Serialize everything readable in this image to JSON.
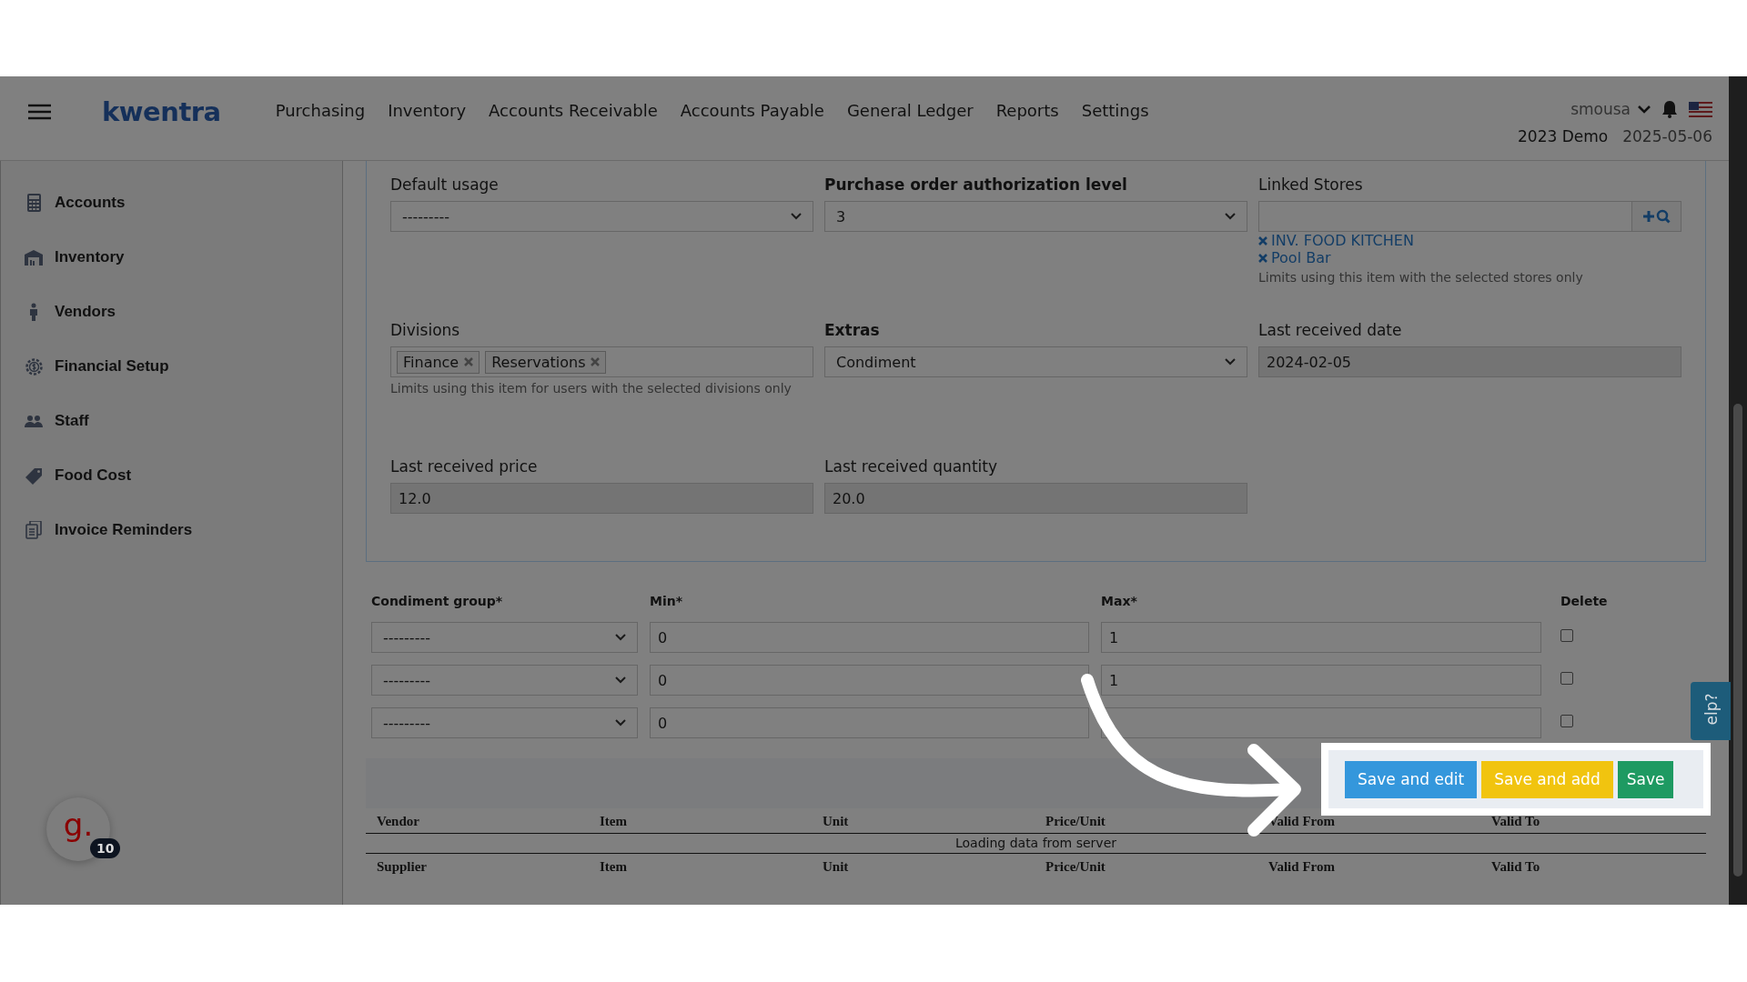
{
  "brand": "kwentra",
  "nav_items": [
    "Purchasing",
    "Inventory",
    "Accounts Receivable",
    "Accounts Payable",
    "General Ledger",
    "Reports",
    "Settings"
  ],
  "user": {
    "name": "smousa",
    "company": "2023 Demo",
    "date": "2025-05-06"
  },
  "sidebar": {
    "items": [
      "Accounts",
      "Inventory",
      "Vendors",
      "Financial Setup",
      "Staff",
      "Food Cost",
      "Invoice Reminders"
    ]
  },
  "form": {
    "rows": [
      [
        {
          "label": "Default usage",
          "bold": false,
          "kind": "select",
          "value": "---------"
        },
        {
          "label": "Purchase order authorization level",
          "bold": true,
          "kind": "select",
          "value": "3"
        },
        {
          "label": "Linked Stores",
          "bold": false,
          "kind": "lookup",
          "items": [
            "INV. FOOD KITCHEN",
            "Pool Bar"
          ],
          "help": "Limits using this item with the selected stores only"
        }
      ],
      [
        {
          "label": "Divisions",
          "bold": false,
          "kind": "tags",
          "tags": [
            "Finance",
            "Reservations"
          ],
          "help": "Limits using this item for users with the selected divisions only"
        },
        {
          "label": "Extras",
          "bold": true,
          "kind": "select",
          "value": "Condiment"
        },
        {
          "label": "Last received date",
          "bold": false,
          "kind": "readonly",
          "value": "2024-02-05"
        }
      ],
      [
        {
          "label": "Last received price",
          "bold": false,
          "kind": "readonly",
          "value": "12.0"
        },
        {
          "label": "Last received quantity",
          "bold": false,
          "kind": "readonly",
          "value": "20.0"
        }
      ]
    ]
  },
  "condiments": {
    "columns": [
      "Condiment group*",
      "Min*",
      "Max*",
      "Delete"
    ],
    "rows": [
      {
        "group": "---------",
        "min": "0",
        "max": "1",
        "delete": false
      },
      {
        "group": "---------",
        "min": "0",
        "max": "1",
        "delete": false
      },
      {
        "group": "---------",
        "min": "0",
        "delete": false
      }
    ]
  },
  "vendor_table": {
    "columns": [
      "Vendor",
      "Item",
      "Unit",
      "Price/Unit",
      "Valid From",
      "Valid To"
    ],
    "status": "Loading data from server"
  },
  "supplier_table": {
    "columns": [
      "Supplier",
      "Item",
      "Unit",
      "Price/Unit",
      "Valid From",
      "Valid To"
    ]
  },
  "actions": [
    {
      "label": "Save and edit",
      "kind": "primary"
    },
    {
      "label": "Save and add",
      "kind": "warning"
    },
    {
      "label": "Save",
      "kind": "success"
    }
  ],
  "help_tab": {
    "label": "elp?"
  },
  "chat": {
    "logo": "g.",
    "count": "10"
  }
}
